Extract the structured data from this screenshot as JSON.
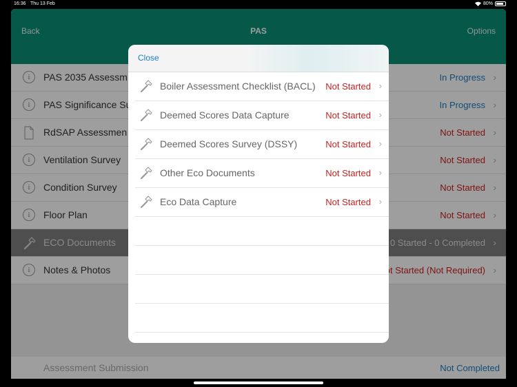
{
  "status_bar": {
    "time": "16:36",
    "date": "Thu 13 Feb",
    "battery": "80%"
  },
  "navbar": {
    "back": "Back",
    "title": "PAS",
    "options": "Options"
  },
  "rows": [
    {
      "label": "PAS 2035 Assessm",
      "status": "In Progress",
      "icon": "info-icon"
    },
    {
      "label": "PAS Significance Su",
      "status": "In Progress",
      "icon": "info-icon"
    },
    {
      "label": "RdSAP Assessmen",
      "status": "Not Started",
      "icon": "document-icon"
    },
    {
      "label": "Ventilation Survey",
      "status": "Not Started",
      "icon": "info-icon"
    },
    {
      "label": "Condition Survey",
      "status": "Not Started",
      "icon": "info-icon"
    },
    {
      "label": "Floor Plan",
      "status": "Not Started",
      "icon": "info-icon"
    },
    {
      "label": "ECO Documents",
      "status": "0 Started - 0 Completed",
      "icon": "hammer-icon"
    },
    {
      "label": "Notes & Photos",
      "status": "ot Started (Not Required)",
      "icon": "info-icon"
    }
  ],
  "submission": {
    "label": "Assessment Submission",
    "status": "Not Completed"
  },
  "modal": {
    "close": "Close",
    "items": [
      {
        "label": "Boiler Assessment Checklist (BACL)",
        "status": "Not Started"
      },
      {
        "label": "Deemed Scores Data Capture",
        "status": "Not Started"
      },
      {
        "label": "Deemed Scores Survey (DSSY)",
        "status": "Not Started"
      },
      {
        "label": "Other Eco Documents",
        "status": "Not Started"
      },
      {
        "label": "Eco Data Capture",
        "status": "Not Started"
      }
    ]
  },
  "colors": {
    "nav_green": "#0a8f77",
    "link_blue": "#1d7cc0",
    "status_red": "#cc1f1f"
  }
}
